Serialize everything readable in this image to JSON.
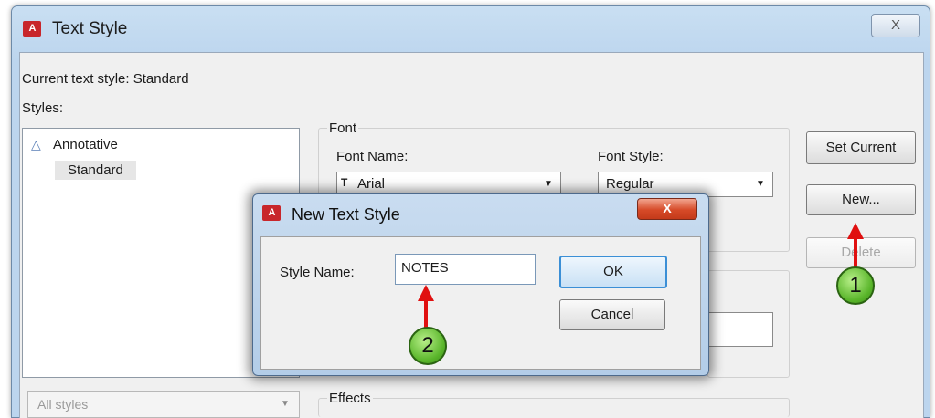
{
  "main_window": {
    "title": "Text Style",
    "app_icon": "autocad-icon",
    "close_label": "X",
    "current_style_text": "Current text style:  Standard",
    "styles_label": "Styles:",
    "styles": [
      "Annotative",
      "Standard"
    ],
    "filter_value": "All styles",
    "font_group_label": "Font",
    "font_name_label": "Font Name:",
    "font_name_value": "Arial",
    "font_style_label": "Font Style:",
    "font_style_value": "Regular",
    "effects_label": "Effects",
    "buttons": {
      "set_current": "Set Current",
      "new": "New...",
      "delete": "Delete"
    }
  },
  "new_dialog": {
    "title": "New Text Style",
    "close_label": "X",
    "style_name_label": "Style Name:",
    "style_name_value": "NOTES",
    "ok": "OK",
    "cancel": "Cancel"
  },
  "annotations": {
    "callout_1": "1",
    "callout_2": "2",
    "arrow_color": "#e01010",
    "callout_color": "#59b52a"
  }
}
